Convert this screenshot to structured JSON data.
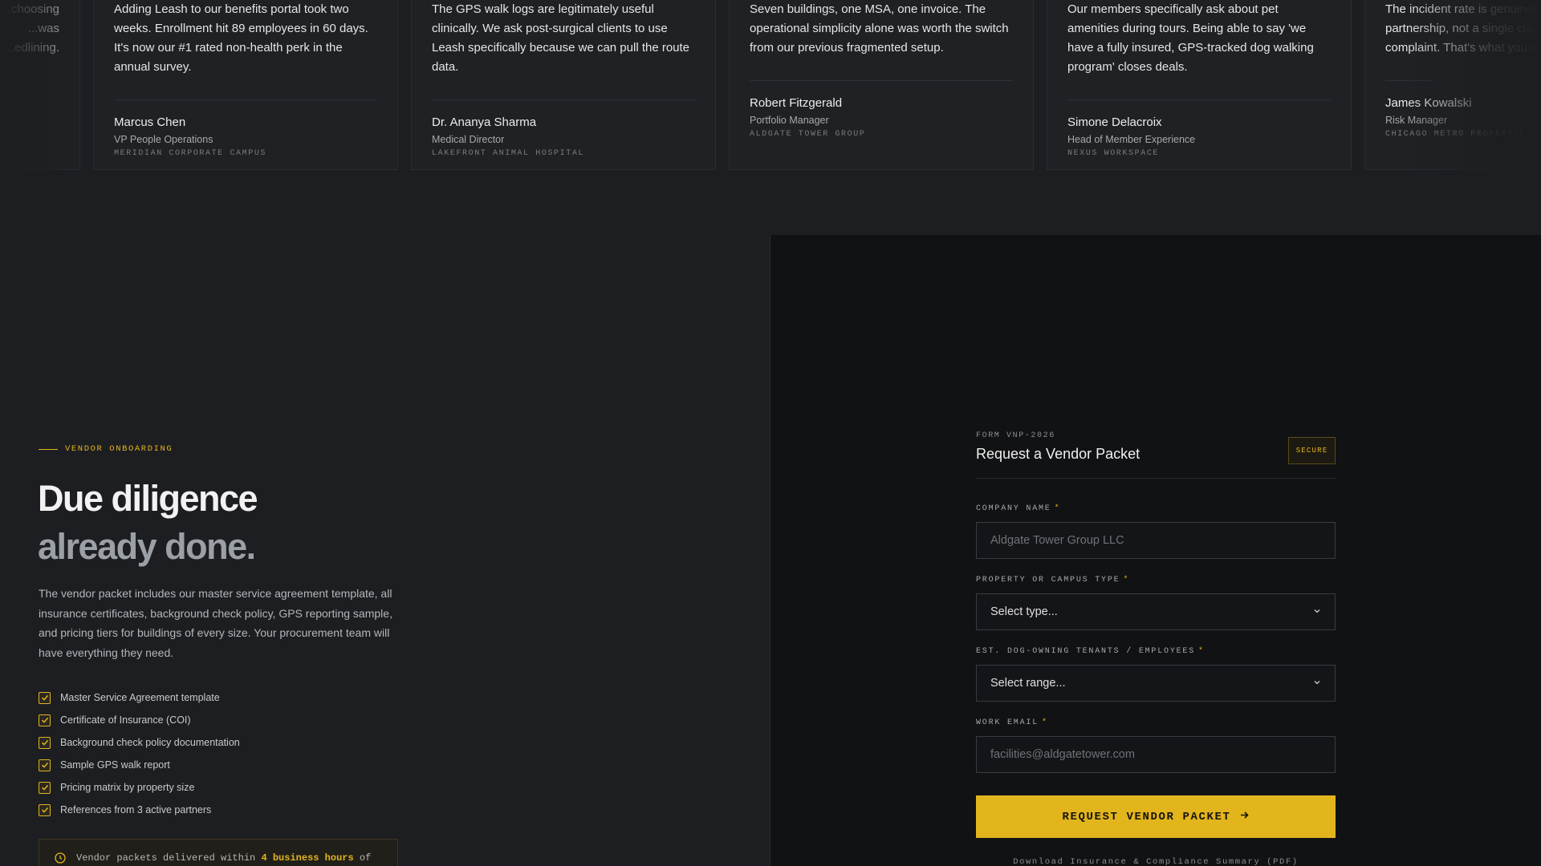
{
  "testimonials": [
    {
      "quote": "...choosing\n...was\n...edlining.",
      "name": "",
      "role": "",
      "company": ""
    },
    {
      "quote": "Adding Leash to our benefits portal took two weeks. Enrollment hit 89 employees in 60 days. It's now our #1 rated non-health perk in the annual survey.",
      "name": "Marcus Chen",
      "role": "VP People Operations",
      "company": "Meridian Corporate Campus"
    },
    {
      "quote": "The GPS walk logs are legitimately useful clinically. We ask post-surgical clients to use Leash specifically because we can pull the route data.",
      "name": "Dr. Ananya Sharma",
      "role": "Medical Director",
      "company": "Lakefront Animal Hospital"
    },
    {
      "quote": "Seven buildings, one MSA, one invoice. The operational simplicity alone was worth the switch from our previous fragmented setup.",
      "name": "Robert Fitzgerald",
      "role": "Portfolio Manager",
      "company": "Aldgate Tower Group"
    },
    {
      "quote": "Our members specifically ask about pet amenities during tours. Being able to say 'we have a fully insured, GPS-tracked dog walking program' closes deals.",
      "name": "Simone Delacroix",
      "role": "Head of Member Experience",
      "company": "Nexus Workspace"
    },
    {
      "quote": "The incident rate is genuinely zero. We've had a partnership, not a single claim, not a single complaint. That's what you need.",
      "name": "James Kowalski",
      "role": "Risk Manager",
      "company": "Chicago Metro Properties"
    }
  ],
  "left": {
    "eyebrow": "VENDOR ONBOARDING",
    "headline_line1": "Due diligence",
    "headline_line2": "already done.",
    "intro": "The vendor packet includes our master service agreement template, all insurance certificates, background check policy, GPS reporting sample, and pricing tiers for buildings of every size. Your procurement team will have everything they need.",
    "checklist": [
      "Master Service Agreement template",
      "Certificate of Insurance (COI)",
      "Background check policy documentation",
      "Sample GPS walk report",
      "Pricing matrix by property size",
      "References from 3 active partners"
    ],
    "notice_prefix": "Vendor packets delivered within",
    "notice_highlight": "4 business hours",
    "notice_suffix": "of"
  },
  "form": {
    "code": "FORM VNP-2026",
    "title": "Request a Vendor Packet",
    "badge": "SECURE",
    "fields": {
      "company": {
        "label": "COMPANY NAME",
        "placeholder": "Aldgate Tower Group LLC"
      },
      "property_type": {
        "label": "PROPERTY OR CAMPUS TYPE",
        "value": "Select type..."
      },
      "tenants": {
        "label": "EST. DOG-OWNING TENANTS / EMPLOYEES",
        "value": "Select range..."
      },
      "email": {
        "label": "WORK EMAIL",
        "placeholder": "facilities@aldgatetower.com"
      }
    },
    "required_mark": "*",
    "submit_label": "REQUEST VENDOR PACKET",
    "footnote": "Download Insurance & Compliance Summary (PDF)"
  },
  "colors": {
    "accent": "#e2b51c",
    "page_bg": "#1c1e22",
    "panel_bg": "#111214"
  },
  "icons": {
    "check": "check-icon",
    "chevron": "chevron-down-icon",
    "arrow": "arrow-right-icon",
    "clock": "clock-icon"
  }
}
